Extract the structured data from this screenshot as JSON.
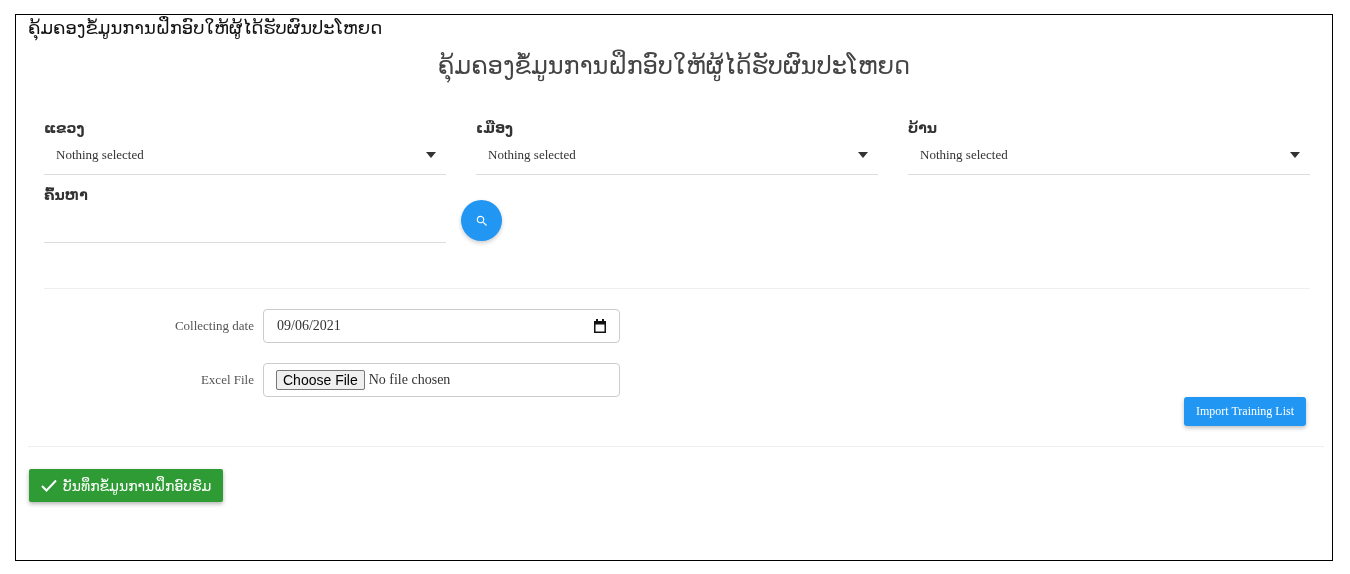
{
  "page_title": "ຄຸ້ມຄອງຂໍ້ມູນການຝຶກອົບໃຫ້ຜູ້ໄດ້ຮັບຜົນປະໂຫຍດ",
  "heading": "ຄຸ້ມຄອງຂໍ້ມູນການຝຶກອົບໃຫ້ຜູ້ໄດ້ຮັບຜົນປະໂຫຍດ",
  "filters": [
    {
      "label": "ແຂວງ",
      "value": "Nothing selected"
    },
    {
      "label": "ເມືອງ",
      "value": "Nothing selected"
    },
    {
      "label": "ບ້ານ",
      "value": "Nothing selected"
    }
  ],
  "search": {
    "label": "ຄົ້ນຫາ"
  },
  "import_form": {
    "date_label": "Collecting date",
    "date_value": "09/06/2021",
    "file_label": "Excel File",
    "file_button": "Choose File",
    "file_status": "No file chosen",
    "import_button": "Import Training List"
  },
  "save_button": "ບັນທຶກຂໍ້ມູນການຝຶກອົບຮົມ"
}
